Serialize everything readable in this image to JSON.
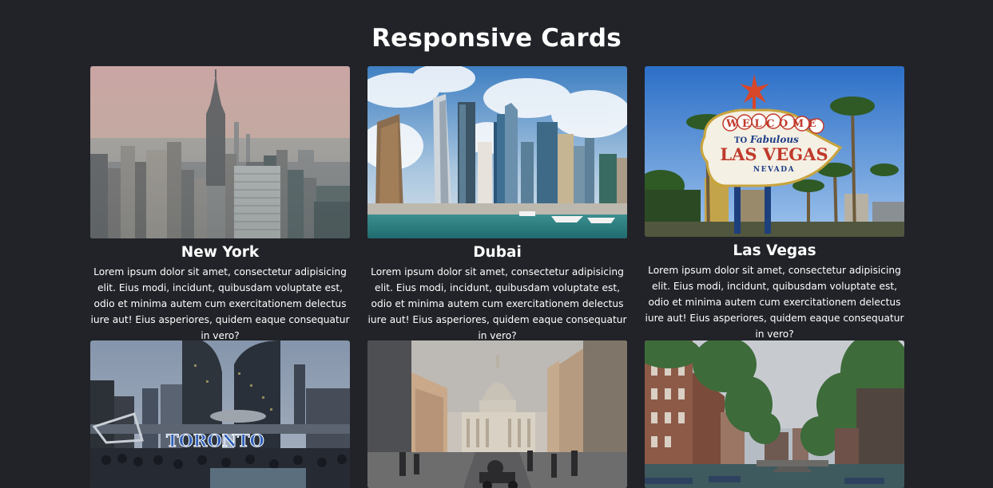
{
  "header": {
    "title": "Responsive Cards"
  },
  "cards": [
    {
      "title": "New York",
      "description": "Lorem ipsum dolor sit amet, consectetur adipisicing elit. Eius modi, incidunt, quibusdam voluptate est, odio et minima autem cum exercitationem delectus iure aut! Eius asperiores, quidem eaque consequatur in vero?",
      "image": "new-york-skyline-photo"
    },
    {
      "title": "Dubai",
      "description": "Lorem ipsum dolor sit amet, consectetur adipisicing elit. Eius modi, incidunt, quibusdam voluptate est, odio et minima autem cum exercitationem delectus iure aut! Eius asperiores, quidem eaque consequatur in vero?",
      "image": "dubai-marina-photo"
    },
    {
      "title": "Las Vegas",
      "description": "Lorem ipsum dolor sit amet, consectetur adipisicing elit. Eius modi, incidunt, quibusdam voluptate est, odio et minima autem cum exercitationem delectus iure aut! Eius asperiores, quidem eaque consequatur in vero?",
      "image": "las-vegas-sign-photo",
      "sign": {
        "welcome": "WELCOME",
        "to": "TO",
        "fabulous": "Fabulous",
        "city": "LAS VEGAS",
        "state": "NEVADA"
      }
    },
    {
      "title": "",
      "description": "",
      "image": "toronto-square-photo",
      "sign": "TORONTO"
    },
    {
      "title": "",
      "description": "",
      "image": "rome-street-photo"
    },
    {
      "title": "",
      "description": "",
      "image": "amsterdam-canal-photo"
    }
  ],
  "colors": {
    "background": "#212328",
    "text": "#ffffff"
  }
}
